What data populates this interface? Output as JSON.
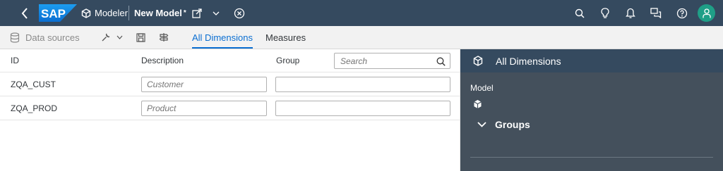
{
  "shell": {
    "logo_text": "SAP",
    "app_name": "Modeler",
    "doc_title": "New Model",
    "unsaved_marker": "*",
    "colors": {
      "shell_bg": "#354a5f",
      "avatar_bg": "#1f9f87",
      "logo_blue": "#0a7fd8"
    },
    "icons": [
      "back-icon",
      "modeler-cube-icon",
      "export-icon",
      "chevron-down-icon",
      "close-circle-icon",
      "search-icon",
      "lightbulb-icon",
      "bell-icon",
      "chat-icon",
      "help-icon",
      "user-icon"
    ]
  },
  "toolbar": {
    "data_sources_label": "Data sources",
    "tabs": [
      {
        "label": "All Dimensions",
        "active": true
      },
      {
        "label": "Measures",
        "active": false
      }
    ]
  },
  "grid": {
    "columns": {
      "id": "ID",
      "description": "Description",
      "group": "Group"
    },
    "search_placeholder": "Search",
    "rows": [
      {
        "id": "ZQA_CUST",
        "description_placeholder": "Customer",
        "group": ""
      },
      {
        "id": "ZQA_PROD",
        "description_placeholder": "Product",
        "group": ""
      }
    ]
  },
  "panel": {
    "title": "All Dimensions",
    "model_label": "Model",
    "groups_label": "Groups"
  }
}
